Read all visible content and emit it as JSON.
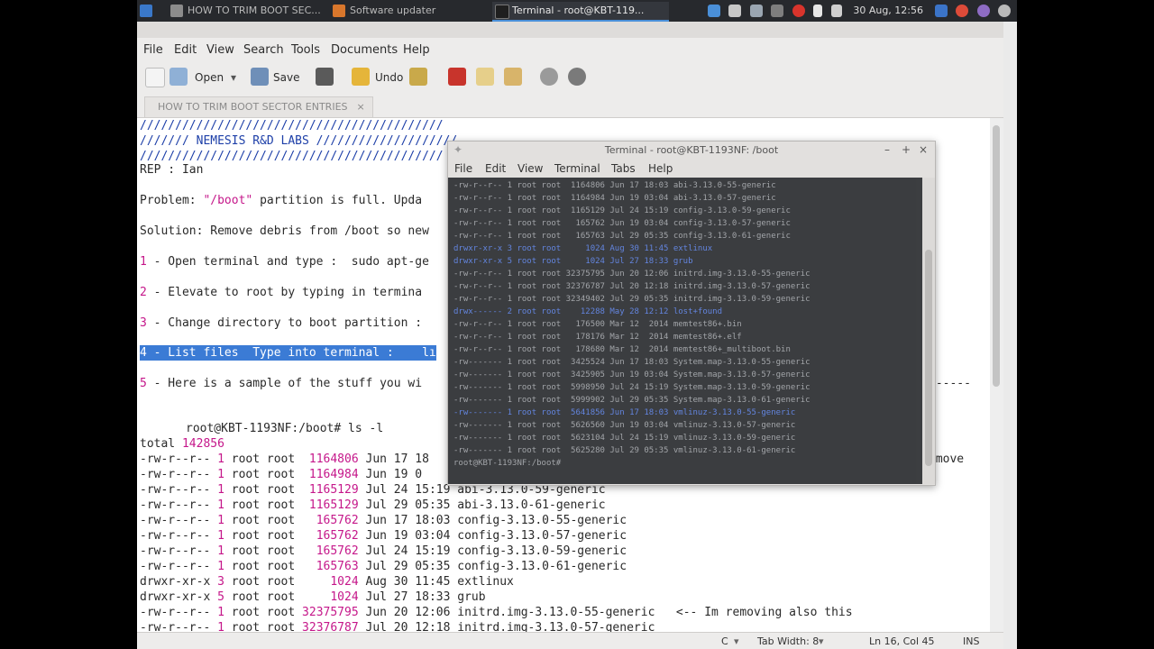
{
  "panel": {
    "tasks": [
      {
        "label": "",
        "icon": "menu-icon",
        "active": false
      },
      {
        "label": "HOW TO TRIM BOOT SEC...",
        "icon": "gedit-icon",
        "active": false
      },
      {
        "label": "Software updater",
        "icon": "updater-icon",
        "active": false
      },
      {
        "label": "Terminal - root@KBT-119...",
        "icon": "terminal-icon",
        "active": true
      }
    ],
    "clock": "30 Aug, 12:56"
  },
  "editor": {
    "menu": [
      "File",
      "Edit",
      "View",
      "Search",
      "Tools",
      "Documents",
      "Help"
    ],
    "toolbar": {
      "open": "Open",
      "save": "Save",
      "undo": "Undo"
    },
    "tab": "HOW TO TRIM BOOT SECTOR ENTRIES",
    "header_lines": [
      "///////////////////////////////////////////",
      "/////// NEMESIS R&D LABS ////////////////////",
      "///////////////////////////////////////////"
    ],
    "rep": "REP : Ian",
    "problem": {
      "a": "Problem: ",
      "b": "\"/boot\"",
      "c": " partition is full. Upda"
    },
    "solution": "Solution: Remove debris from /boot so new",
    "steps": [
      {
        "n": "1",
        "text": " - Open terminal and type :  sudo apt-ge"
      },
      {
        "n": "2",
        "text": " - Elevate to root by typing in termina"
      },
      {
        "n": "3",
        "text": " - Change directory to boot partition :"
      },
      {
        "n": "4",
        "text": " - List files  Type into terminal :    lı"
      },
      {
        "n": "5",
        "text": " - Here is a sample of the stuff you wi"
      }
    ],
    "step5_tail": "------",
    "prompt": "root@KBT-1193NF:/boot# ls -l",
    "total_label": "total ",
    "total_value": "142856",
    "listing": [
      {
        "perm": "-rw-r--r--",
        "n": "1",
        "owner": "root root",
        "size": "1164806",
        "date": "Jun 17 18",
        "name": "",
        "note": ""
      },
      {
        "perm": "-rw-r--r--",
        "n": "1",
        "owner": "root root",
        "size": "1164984",
        "date": "Jun 19 0",
        "name": "",
        "note": ""
      },
      {
        "perm": "-rw-r--r--",
        "n": "1",
        "owner": "root root",
        "size": "1165129",
        "date": "Jul 24 15:19",
        "name": "abi-3.13.0-59-generic",
        "note": ""
      },
      {
        "perm": "-rw-r--r--",
        "n": "1",
        "owner": "root root",
        "size": "1165129",
        "date": "Jul 29 05:35",
        "name": "abi-3.13.0-61-generic",
        "note": ""
      },
      {
        "perm": "-rw-r--r--",
        "n": "1",
        "owner": "root root",
        "size": " 165762",
        "date": "Jun 17 18:03",
        "name": "config-3.13.0-55-generic",
        "note": ""
      },
      {
        "perm": "-rw-r--r--",
        "n": "1",
        "owner": "root root",
        "size": " 165762",
        "date": "Jun 19 03:04",
        "name": "config-3.13.0-57-generic",
        "note": ""
      },
      {
        "perm": "-rw-r--r--",
        "n": "1",
        "owner": "root root",
        "size": " 165762",
        "date": "Jul 24 15:19",
        "name": "config-3.13.0-59-generic",
        "note": ""
      },
      {
        "perm": "-rw-r--r--",
        "n": "1",
        "owner": "root root",
        "size": " 165763",
        "date": "Jul 29 05:35",
        "name": "config-3.13.0-61-generic",
        "note": ""
      },
      {
        "perm": "drwxr-xr-x",
        "n": "3",
        "owner": "root root",
        "size": "   1024",
        "date": "Aug 30 11:45",
        "name": "extlinux",
        "note": ""
      },
      {
        "perm": "drwxr-xr-x",
        "n": "5",
        "owner": "root root",
        "size": "   1024",
        "date": "Jul 27 18:33",
        "name": "grub",
        "note": ""
      },
      {
        "perm": "-rw-r--r--",
        "n": "1",
        "owner": "root root",
        "size": "32375795",
        "date": "Jun 20 12:06",
        "name": "initrd.img-3.13.0-55-generic",
        "note": "   <-- Im removing also this"
      },
      {
        "perm": "-rw-r--r--",
        "n": "1",
        "owner": "root root",
        "size": "32376787",
        "date": "Jul 20 12:18",
        "name": "initrd.img-3.13.0-57-generic",
        "note": ""
      }
    ],
    "right_note_a": "r",
    "right_note_b": "emove",
    "status": {
      "lang": "C",
      "tabwidth": "Tab Width: 8",
      "position": "Ln 16, Col 45",
      "mode": "INS"
    }
  },
  "terminal": {
    "title": "Terminal - root@KBT-1193NF: /boot",
    "menu": [
      "File",
      "Edit",
      "View",
      "Terminal",
      "Tabs",
      "Help"
    ],
    "lines": [
      {
        "t": "-rw-r--r-- 1 root root  1164806 Jun 17 18:03 abi-3.13.0-55-generic",
        "blue": false
      },
      {
        "t": "-rw-r--r-- 1 root root  1164984 Jun 19 03:04 abi-3.13.0-57-generic",
        "blue": false
      },
      {
        "t": "-rw-r--r-- 1 root root  1165129 Jul 24 15:19 config-3.13.0-59-generic",
        "blue": false
      },
      {
        "t": "-rw-r--r-- 1 root root   165762 Jun 19 03:04 config-3.13.0-57-generic",
        "blue": false
      },
      {
        "t": "-rw-r--r-- 1 root root   165763 Jul 29 05:35 config-3.13.0-61-generic",
        "blue": false
      },
      {
        "t": "drwxr-xr-x 3 root root     1024 Aug 30 11:45 extlinux",
        "blue": true
      },
      {
        "t": "drwxr-xr-x 5 root root     1024 Jul 27 18:33 grub",
        "blue": true
      },
      {
        "t": "-rw-r--r-- 1 root root 32375795 Jun 20 12:06 initrd.img-3.13.0-55-generic",
        "blue": false
      },
      {
        "t": "-rw-r--r-- 1 root root 32376787 Jul 20 12:18 initrd.img-3.13.0-57-generic",
        "blue": false
      },
      {
        "t": "-rw-r--r-- 1 root root 32349402 Jul 29 05:35 initrd.img-3.13.0-59-generic",
        "blue": false
      },
      {
        "t": "drwx------ 2 root root    12288 May 28 12:12 lost+found",
        "blue": true
      },
      {
        "t": "-rw-r--r-- 1 root root   176500 Mar 12  2014 memtest86+.bin",
        "blue": false
      },
      {
        "t": "-rw-r--r-- 1 root root   178176 Mar 12  2014 memtest86+.elf",
        "blue": false
      },
      {
        "t": "-rw-r--r-- 1 root root   178680 Mar 12  2014 memtest86+_multiboot.bin",
        "blue": false
      },
      {
        "t": "-rw------- 1 root root  3425524 Jun 17 18:03 System.map-3.13.0-55-generic",
        "blue": false
      },
      {
        "t": "-rw------- 1 root root  3425905 Jun 19 03:04 System.map-3.13.0-57-generic",
        "blue": false
      },
      {
        "t": "-rw------- 1 root root  5998950 Jul 24 15:19 System.map-3.13.0-59-generic",
        "blue": false
      },
      {
        "t": "-rw------- 1 root root  5999902 Jul 29 05:35 System.map-3.13.0-61-generic",
        "blue": false
      },
      {
        "t": "-rw------- 1 root root  5641856 Jun 17 18:03 vmlinuz-3.13.0-55-generic",
        "blue": true
      },
      {
        "t": "-rw------- 1 root root  5626560 Jun 19 03:04 vmlinuz-3.13.0-57-generic",
        "blue": false
      },
      {
        "t": "-rw------- 1 root root  5623104 Jul 24 15:19 vmlinuz-3.13.0-59-generic",
        "blue": false
      },
      {
        "t": "-rw------- 1 root root  5625280 Jul 29 05:35 vmlinuz-3.13.0-61-generic",
        "blue": false
      },
      {
        "t": "root@KBT-1193NF:/boot# ",
        "blue": false
      }
    ]
  }
}
